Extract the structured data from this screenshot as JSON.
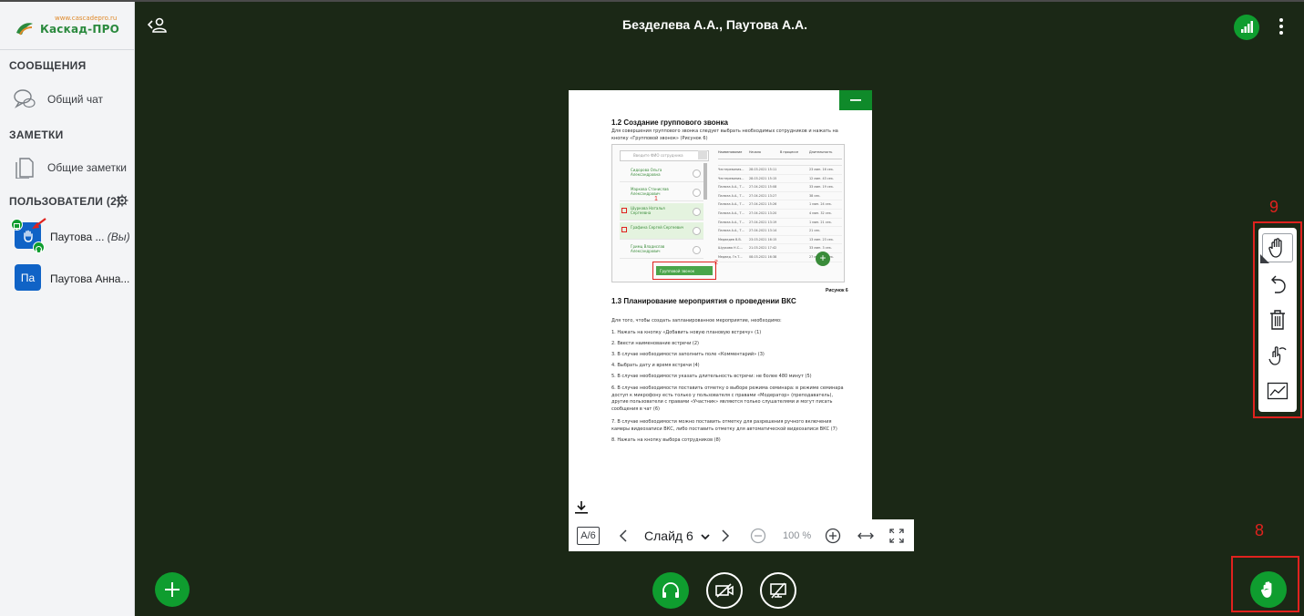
{
  "app": {
    "logo_url": "www.cascadepro.ru",
    "logo_text": "Каскад-ПРО",
    "title": "Безделева А.А., Паутова А.А."
  },
  "sidebar": {
    "messages_header": "СООБЩЕНИЯ",
    "public_chat": "Общий чат",
    "notes_header": "ЗАМЕТКИ",
    "shared_notes": "Общие заметки",
    "users_header": "ПОЛЬЗОВАТЕЛИ (2)",
    "users": [
      {
        "initials": "",
        "name": "Паутова ...",
        "suffix": "(Вы)",
        "avatar_color": "#1063c6"
      },
      {
        "initials": "Па",
        "name": "Паутова Анна...",
        "suffix": "",
        "avatar_color": "#1063c6"
      }
    ]
  },
  "slide": {
    "heading1": "1.2 Создание группового звонка",
    "intro": "Для совершения группового звонка следует выбрать необходимых сотрудников и нажать на кнопку «Групповой звонок» (Рисунок 6)",
    "caption": "Рисунок 6",
    "heading2": "1.3 Планирование мероприятия о проведении ВКС",
    "lead": "Для того, чтобы создать запланированное мероприятие, необходимо:",
    "steps": [
      "1. Нажать на кнопку «Добавить новую плановую встречу» (1)",
      "2. Ввести наименование встречи (2)",
      "3. В случае необходимости заполнить поле «Комментарий» (3)",
      "4. Выбрать дату и время встречи (4)",
      "5. В случае необходимости указать длительность встречи: не более 480 минут (5)",
      "6. В случае необходимости поставить отметку о выборе режима семинара: в режиме семинара доступ к микрофону есть только у пользователя с правами «Модератор» (преподаватель), другие пользователи с правами «Участник» являются только слушателями и могут писать сообщения в чат (6)",
      "7. В случае необходимости можно поставить отметку для разрешения ручного включения камеры видеозаписи ВКС, либо поставить отметку для автоматической видеозаписи ВКС (7)",
      "8. Нажать на кнопку выбора сотрудников (8)"
    ],
    "screenshot": {
      "search_placeholder": "Введите ФИО сотрудника",
      "contacts": [
        "Сидорова Ольга Александровна",
        "Маркова Станислав Александрович",
        "Шуркова Наталья Сергеевна",
        "Графина Сергей Сергеевич",
        "Гримц Владислав Александрович"
      ],
      "columns": [
        "Наименование",
        "Начало",
        "В процессе",
        "Длительность"
      ],
      "rows": [
        [
          "Честеревиния...",
          "28.03.2021 15:11",
          "",
          "23 мин. 16 сек."
        ],
        [
          "Честеревиния...",
          "28.03.2021 15:15",
          "",
          "12 мин. 43 сек."
        ],
        [
          "Палюза А.А., Т...",
          "27.04.2021 15:08",
          "",
          "33 мин. 19 сек."
        ],
        [
          "Палюза А.А., Т...",
          "27.04.2021 13:27",
          "",
          "38 сек."
        ],
        [
          "Палюза А.А., Т...",
          "27.04.2021 15:26",
          "",
          "1 мин. 24 сек."
        ],
        [
          "Палюза А.А., Т...",
          "27.04.2021 13:20",
          "",
          "4 мин. 32 сек."
        ],
        [
          "Палюза А.А., Т...",
          "27.04.2021 13:19",
          "",
          "1 мин. 21 сек."
        ],
        [
          "Палюза А.А., Т...",
          "27.04.2021 13:14",
          "",
          "21 сек."
        ],
        [
          "Медведев В.В.",
          "23.03.2021 16:15",
          "",
          "13 мин. 23 сек."
        ],
        [
          "Шуркова Н.С....",
          "21.03.2021 17:42",
          "",
          "33 мин. 3 сек."
        ],
        [
          "Медвед. Гн.Т...",
          "08.03.2021 16:38",
          "",
          "27 мин. 32 сек."
        ]
      ],
      "group_call_button": "Групповой звонок",
      "marker1": "1",
      "marker2": "2"
    }
  },
  "slide_toolbar": {
    "accessibility": "A/6",
    "slide_label": "Слайд 6",
    "zoom": "100 %"
  },
  "annotations": {
    "tools_marker": "9",
    "hand_marker": "8"
  },
  "colors": {
    "background": "#1b2816",
    "accent": "#0f9d2f",
    "annotation": "#e0221e",
    "avatar": "#1063c6"
  }
}
